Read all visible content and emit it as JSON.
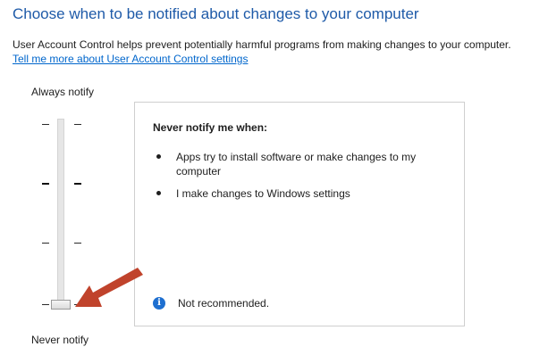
{
  "header": {
    "title": "Choose when to be notified about changes to your computer",
    "description": "User Account Control helps prevent potentially harmful programs from making changes to your computer.",
    "more_link": "Tell me more about User Account Control settings"
  },
  "slider": {
    "top_label": "Always notify",
    "bottom_label": "Never notify",
    "levels": 4,
    "current_level": 1,
    "current_level_description": "lowest of 4 positions (Never notify)"
  },
  "info_box": {
    "heading": "Never notify me when:",
    "bullets": [
      "Apps try to install software or make changes to my computer",
      "I make changes to Windows settings"
    ],
    "note": "Not recommended.",
    "note_icon": "info-icon"
  },
  "annotation": {
    "arrow_icon": "red-arrow-icon",
    "arrow_color": "#c0432c"
  },
  "colors": {
    "title": "#1e5aa8",
    "link": "#0066cc",
    "info_icon": "#1e6fd0"
  }
}
